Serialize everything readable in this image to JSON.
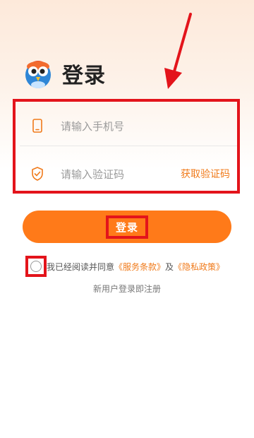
{
  "header": {
    "title": "登录",
    "logo": "owl-logo"
  },
  "form": {
    "phone_placeholder": "请输入手机号",
    "phone_icon": "phone-icon",
    "code_placeholder": "请输入验证码",
    "code_icon": "shield-check-icon",
    "get_code_label": "获取验证码"
  },
  "login_button": {
    "label": "登录"
  },
  "agreement": {
    "prefix": "我已经阅读并同意",
    "terms_link": "《服务条款》",
    "and": "及",
    "privacy_link": "《隐私政策》"
  },
  "register_hint": "新用户登录即注册",
  "colors": {
    "accent": "#ff7a19",
    "highlight": "#e3141b",
    "link": "#f07a1a"
  }
}
